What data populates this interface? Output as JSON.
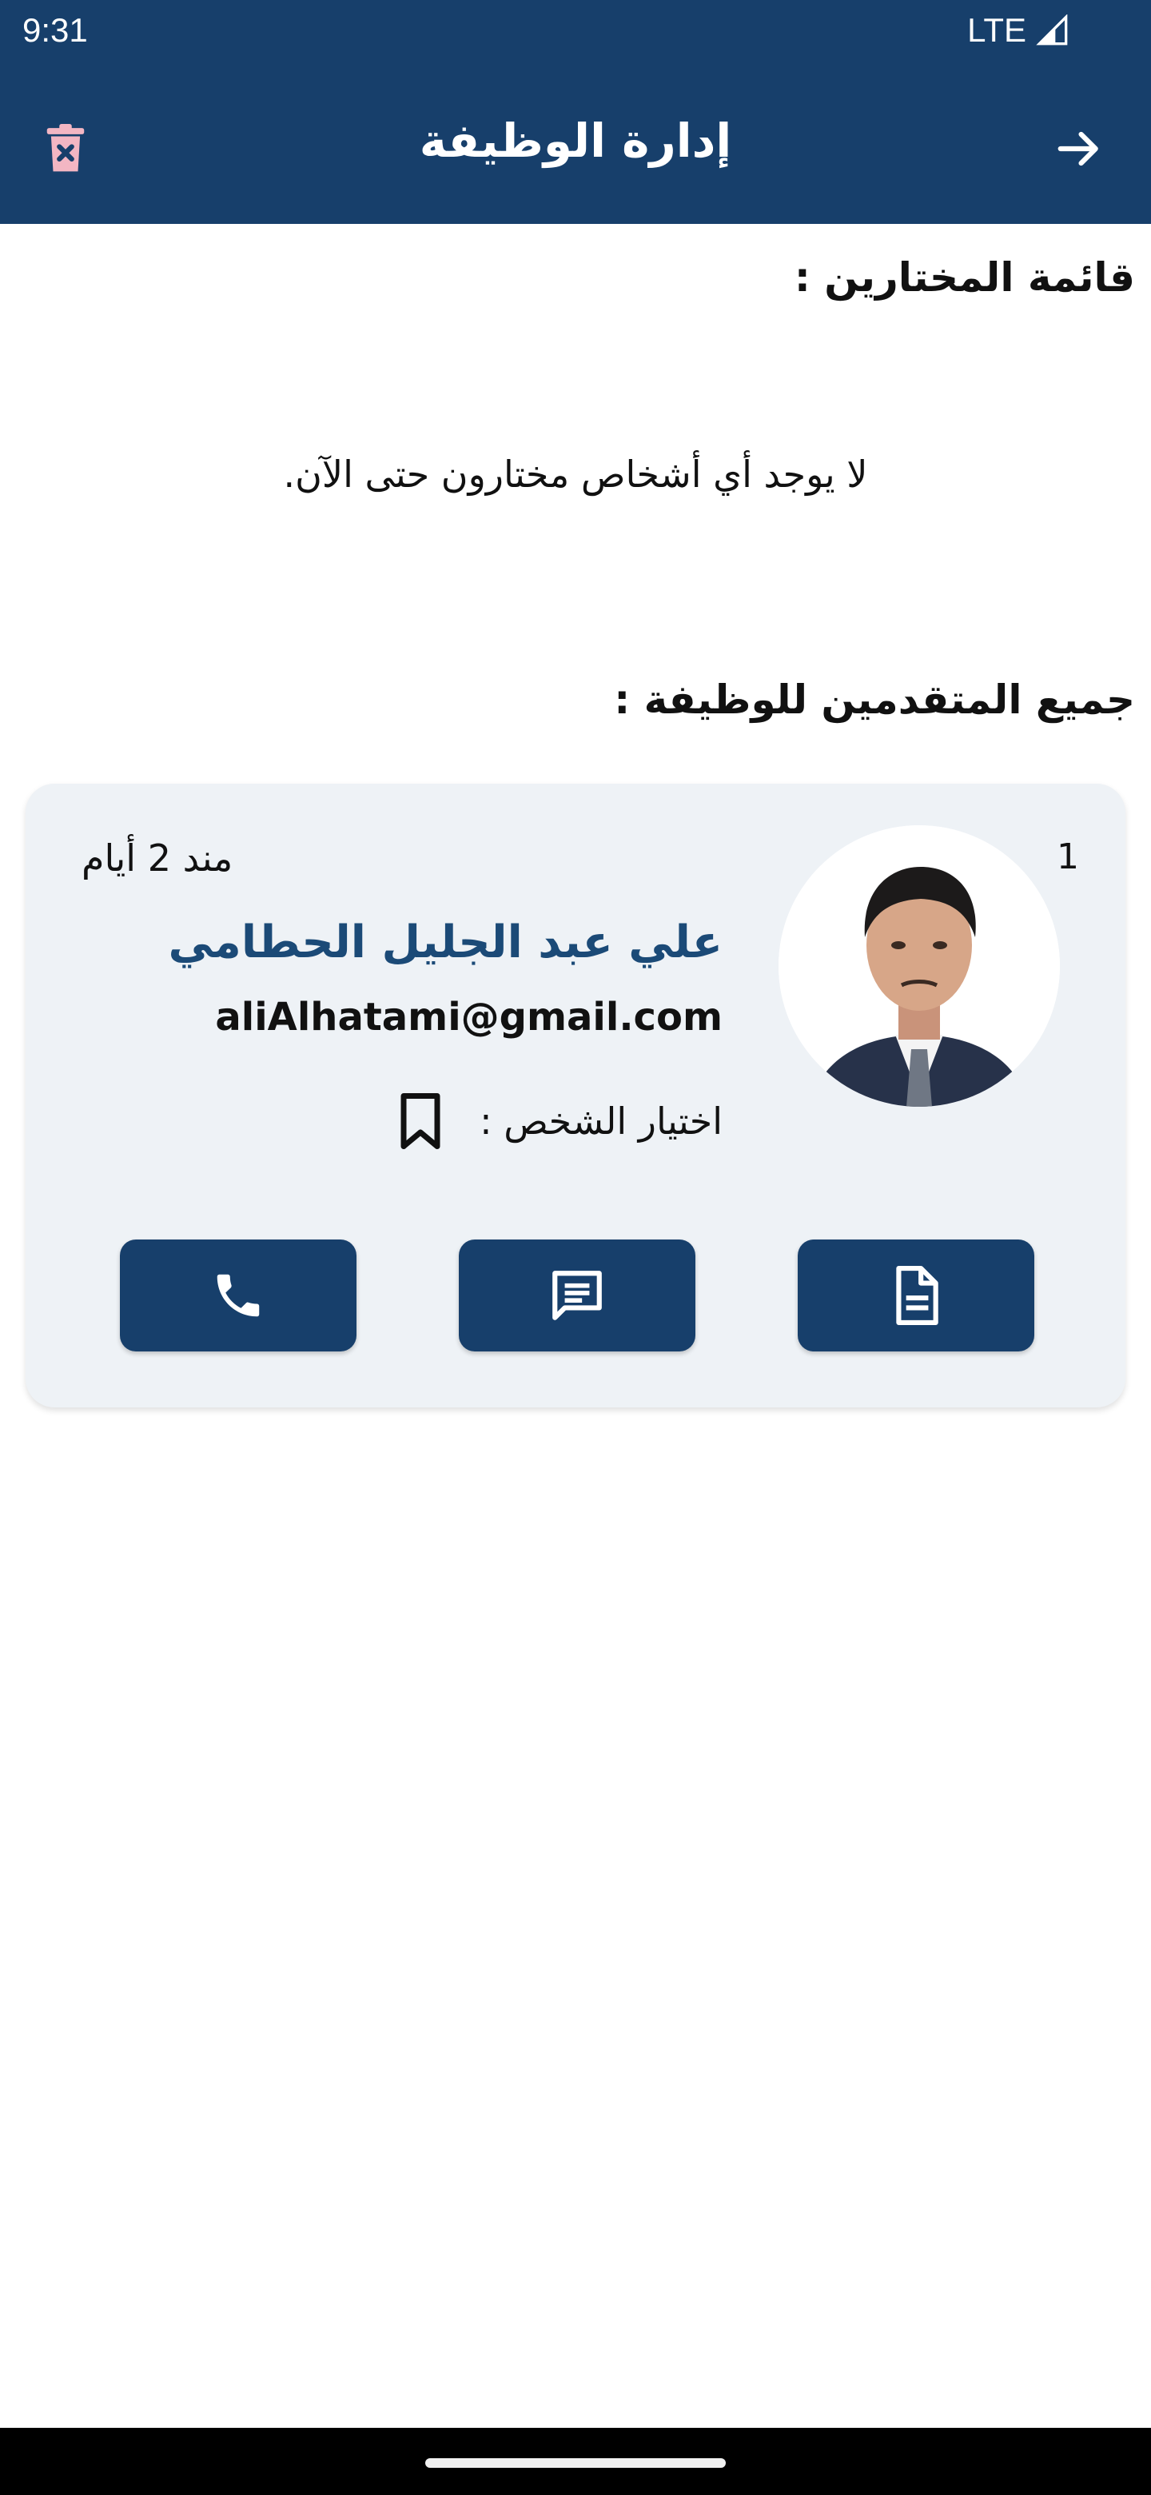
{
  "status": {
    "time": "9:31",
    "network": "LTE"
  },
  "appbar": {
    "title": "إدارة الوظيفة",
    "back_icon": "arrow-right-icon",
    "delete_icon": "trash-icon"
  },
  "selected": {
    "title": "قائمة المختارين :",
    "empty_message": "لا يوجد أي أشخاص مختارون حتى الآن."
  },
  "applicants": {
    "title": "جميع المتقدمين للوظيفة :",
    "items": [
      {
        "rank": "1",
        "date": "مند 2 أيام",
        "name": "علي عبد الجليل الحطامي",
        "email": "aliAlhatami@gmail.com",
        "select_label": "اختيار الشخص :",
        "actions": [
          "document-icon",
          "message-icon",
          "phone-icon"
        ]
      }
    ]
  },
  "colors": {
    "primary": "#173f6b",
    "name": "#1b4a77",
    "card": "#eef2f6",
    "delete": "#f3b6c3"
  }
}
